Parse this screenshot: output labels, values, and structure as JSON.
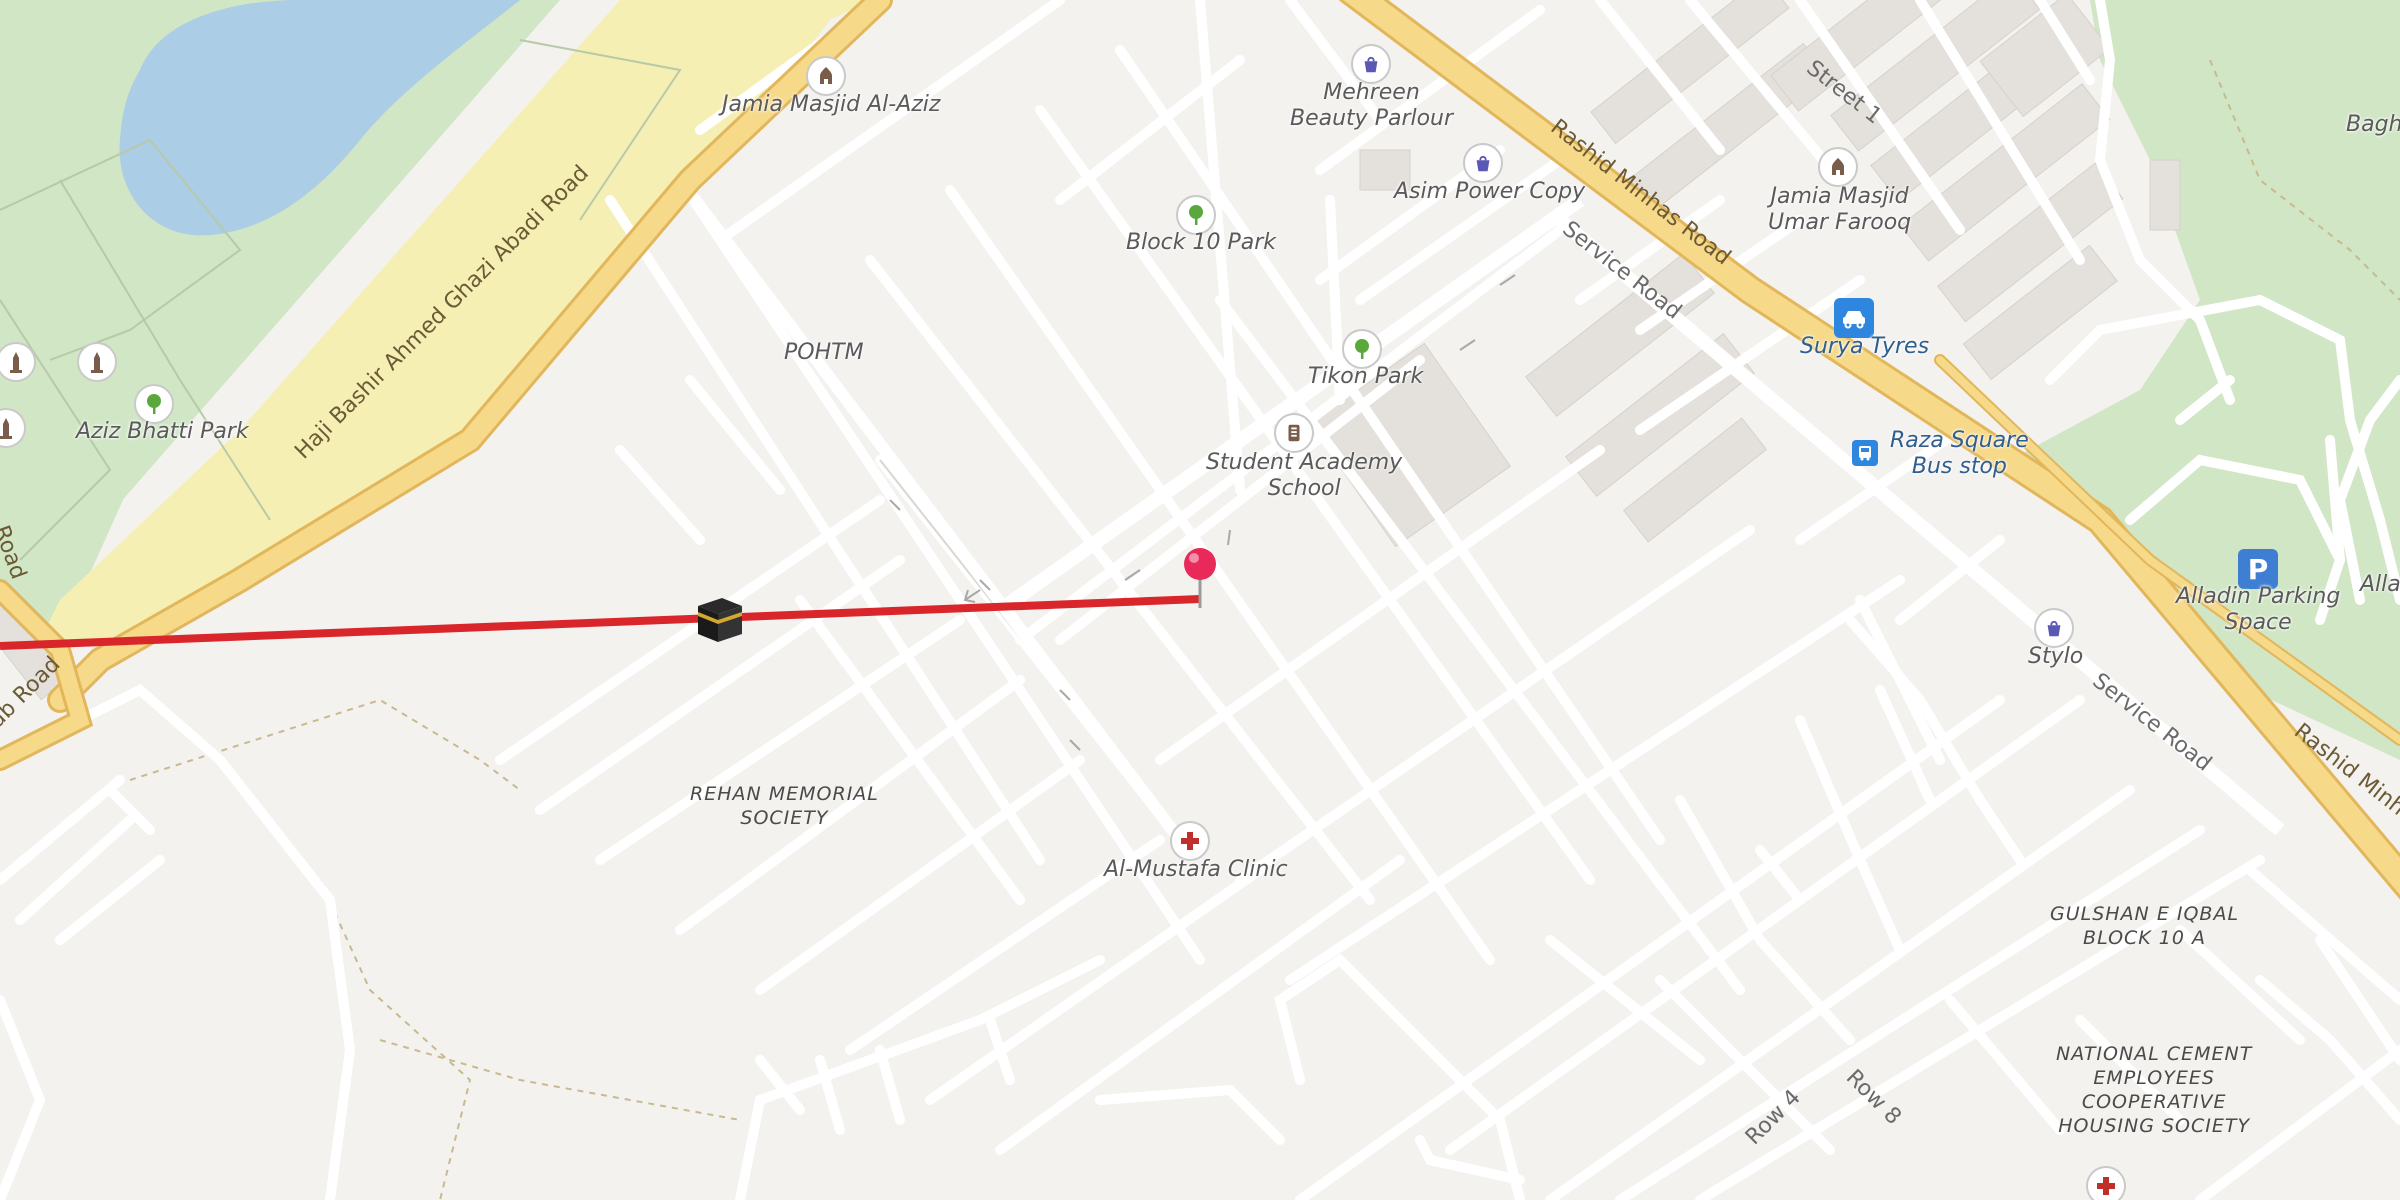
{
  "map": {
    "roads": {
      "haji_bashir": "Haji Bashir Ahmed Ghazi Abadi Road",
      "rashid_minhas_top": "Rashid Minhas Road",
      "rashid_minhas_right": "Rashid Minhas",
      "service_road_top": "Service Road",
      "service_road_right": "Service Road",
      "street_1": "Street 1",
      "row_4": "Row 4",
      "row_8": "Row 8",
      "left_road_top": "Road",
      "left_road_bottom": "ab Road"
    },
    "places": {
      "jamia_masjid_al_aziz": "Jamia Masjid Al-Aziz",
      "mehreen_beauty": "Mehreen\nBeauty Parlour",
      "asim_power_copy": "Asim Power Copy",
      "block_10_park": "Block 10 Park",
      "jamia_masjid_umar": "Jamia Masjid\nUmar Farooq",
      "pohtm": "POHTM",
      "tikon_park": "Tikon Park",
      "surya_tyres": "Surya Tyres",
      "student_academy": "Student Academy\nSchool",
      "raza_square": "Raza Square\nBus stop",
      "aziz_bhatti_park": "Aziz Bhatti Park",
      "alladin_parking": "Alladin Parking\nSpace",
      "alla_cut": "Alla",
      "stylo": "Stylo",
      "al_mustafa": "Al-Mustafa Clinic",
      "bagh_cut": "Bagh"
    },
    "areas": {
      "rehan": "REHAN MEMORIAL\nSOCIETY",
      "gulshan": "GULSHAN E IQBAL\nBLOCK 10 A",
      "national_cement": "NATIONAL CEMENT\nEMPLOYEES\nCOOPERATIVE\nHOUSING SOCIETY"
    },
    "icons": {
      "mosque": "mosque-icon",
      "shop": "shopping-bag-icon",
      "park": "tree-icon",
      "school": "school-icon",
      "car": "car-icon",
      "bus": "bus-icon",
      "parking": "parking-icon",
      "clinic": "clinic-cross-icon",
      "kaaba": "kaaba-icon",
      "pin": "location-pin-icon",
      "monument": "monument-icon"
    },
    "colors": {
      "background": "#f4f2ef",
      "park": "#cfe5c4",
      "water": "#abcde5",
      "sand": "#f6efb4",
      "major_road": "#f7d98a",
      "major_road_border": "#e2b65a",
      "minor_road": "#ffffff",
      "qibla_line": "#d9262b",
      "pin": "#e8295a",
      "bus_stop": "#2e86de",
      "parking": "#3f7fd3",
      "clinic_cross": "#c0302a"
    },
    "parking_letter": "P"
  }
}
